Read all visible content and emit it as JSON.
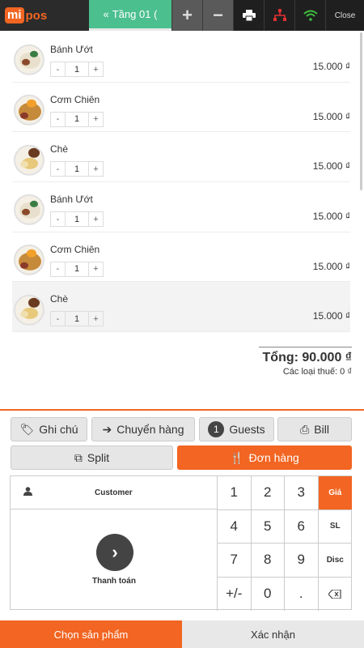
{
  "app": {
    "logo_mi": "mi",
    "logo_pos": "pos"
  },
  "topbar": {
    "tab_label": "Tầng 01 (",
    "close_label": "Close"
  },
  "items": [
    {
      "name": "Bánh Ướt",
      "qty": "1",
      "price": "15.000 ₫",
      "food": "rice-noodle"
    },
    {
      "name": "Cơm Chiên",
      "qty": "1",
      "price": "15.000 ₫",
      "food": "fried-rice"
    },
    {
      "name": "Chè",
      "qty": "1",
      "price": "15.000 ₫",
      "food": "sweet-soup"
    },
    {
      "name": "Bánh Ướt",
      "qty": "1",
      "price": "15.000 ₫",
      "food": "rice-noodle"
    },
    {
      "name": "Cơm Chiên",
      "qty": "1",
      "price": "15.000 ₫",
      "food": "fried-rice"
    },
    {
      "name": "Chè",
      "qty": "1",
      "price": "15.000 ₫",
      "food": "sweet-soup",
      "selected": true
    }
  ],
  "summary": {
    "total": "Tổng: 90.000 ₫",
    "tax": "Các loại thuế: 0 ₫"
  },
  "actions": {
    "note": "Ghi chú",
    "transfer": "Chuyển hàng",
    "guests_count": "1",
    "guests": "Guests",
    "bill": "Bill",
    "split": "Split",
    "order": "Đơn hàng"
  },
  "keypad": {
    "customer": "Customer",
    "pay": "Thanh toán",
    "keys": [
      "1",
      "2",
      "3",
      "Giá",
      "4",
      "5",
      "6",
      "SL",
      "7",
      "8",
      "9",
      "Disc",
      "+/-",
      "0",
      "."
    ]
  },
  "bottom": {
    "choose": "Chọn sản phẩm",
    "confirm": "Xác nhận"
  },
  "colors": {
    "accent": "#f26522",
    "tab": "#4cbf8f",
    "topbar": "#2b2b2b"
  }
}
